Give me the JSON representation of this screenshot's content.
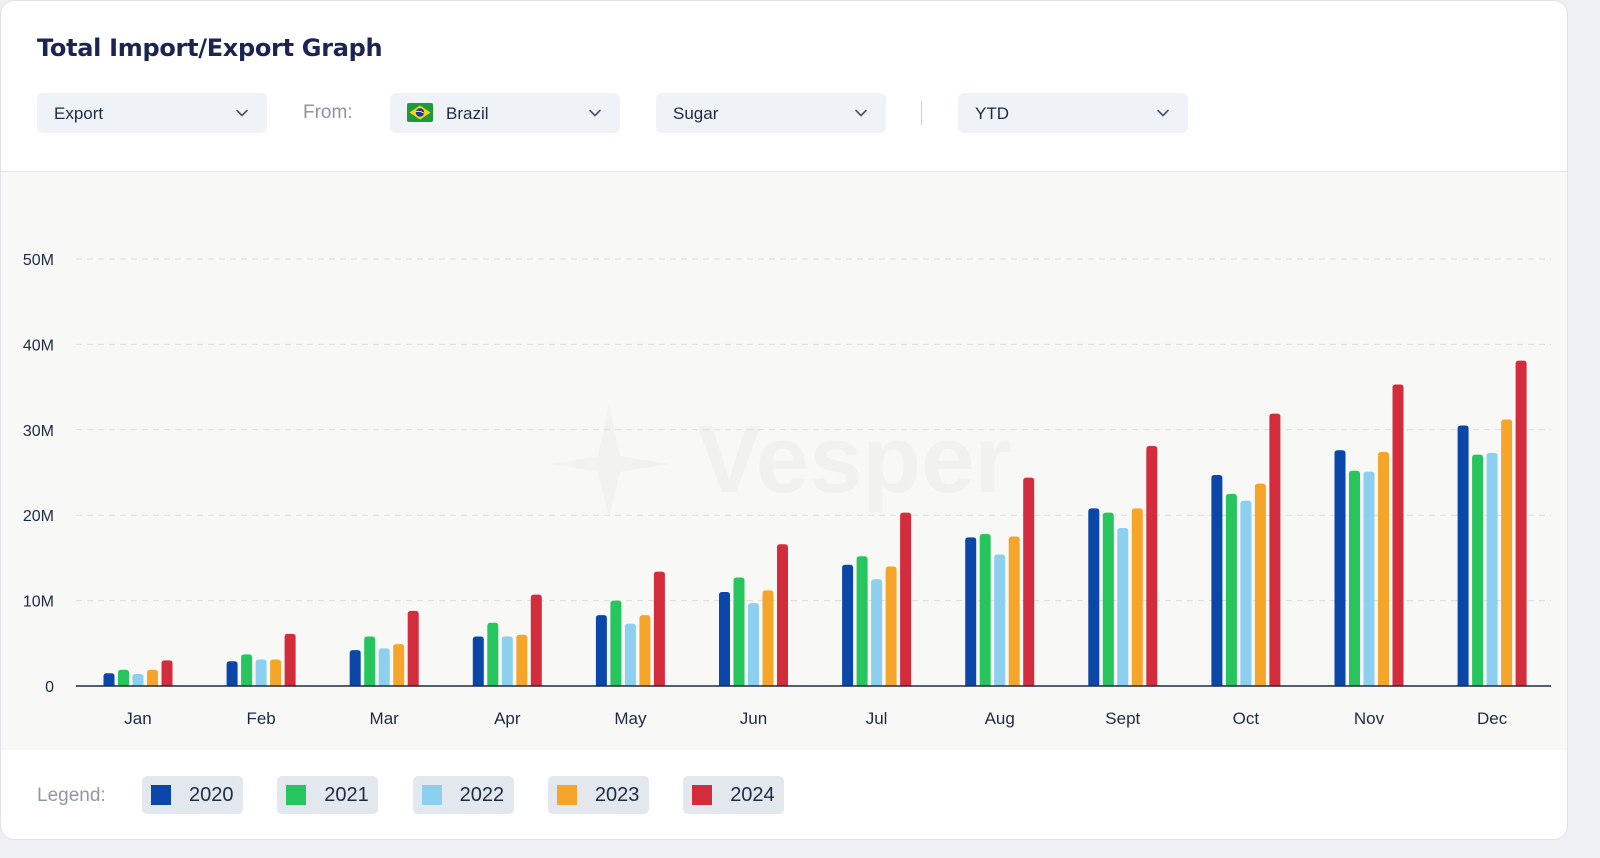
{
  "header": {
    "title": "Total Import/Export Graph",
    "flow_dropdown": {
      "value": "Export"
    },
    "from_label": "From:",
    "country_dropdown": {
      "value": "Brazil",
      "flag_icon": "brazil-flag-icon"
    },
    "commodity_dropdown": {
      "value": "Sugar"
    },
    "period_dropdown": {
      "value": "YTD"
    }
  },
  "legend": {
    "title": "Legend:"
  },
  "watermark": {
    "text": "Vesper"
  },
  "colors": {
    "2020": "#0b47a8",
    "2021": "#27c55e",
    "2022": "#8ccfee",
    "2023": "#f5a62a",
    "2024": "#d32c3d",
    "gridline": "#d9dbde",
    "axis": "#1f2a44"
  },
  "chart_data": {
    "type": "bar",
    "title": "",
    "xlabel": "",
    "ylabel": "",
    "categories": [
      "Jan",
      "Feb",
      "Mar",
      "Apr",
      "May",
      "Jun",
      "Jul",
      "Aug",
      "Sept",
      "Oct",
      "Nov",
      "Dec"
    ],
    "ylim": [
      0,
      50000000
    ],
    "yticks": [
      0,
      10000000,
      20000000,
      30000000,
      40000000,
      50000000
    ],
    "ytick_labels": [
      "0",
      "10M",
      "20M",
      "30M",
      "40M",
      "50M"
    ],
    "grid": true,
    "legend_position": "bottom",
    "series": [
      {
        "name": "2020",
        "color": "#0b47a8",
        "values": [
          1500000,
          2900000,
          4200000,
          5800000,
          8300000,
          11000000,
          14200000,
          17400000,
          20800000,
          24700000,
          27600000,
          30500000
        ]
      },
      {
        "name": "2021",
        "color": "#27c55e",
        "values": [
          1900000,
          3700000,
          5800000,
          7400000,
          10000000,
          12700000,
          15200000,
          17800000,
          20300000,
          22500000,
          25200000,
          27100000
        ]
      },
      {
        "name": "2022",
        "color": "#8ccfee",
        "values": [
          1400000,
          3100000,
          4400000,
          5800000,
          7300000,
          9700000,
          12500000,
          15400000,
          18500000,
          21700000,
          25100000,
          27300000
        ]
      },
      {
        "name": "2023",
        "color": "#f5a62a",
        "values": [
          1900000,
          3100000,
          4900000,
          6000000,
          8300000,
          11200000,
          14000000,
          17500000,
          20800000,
          23700000,
          27400000,
          31200000
        ]
      },
      {
        "name": "2024",
        "color": "#d32c3d",
        "values": [
          3000000,
          6100000,
          8800000,
          10700000,
          13400000,
          16600000,
          20300000,
          24400000,
          28100000,
          31900000,
          35300000,
          38100000
        ]
      }
    ]
  }
}
